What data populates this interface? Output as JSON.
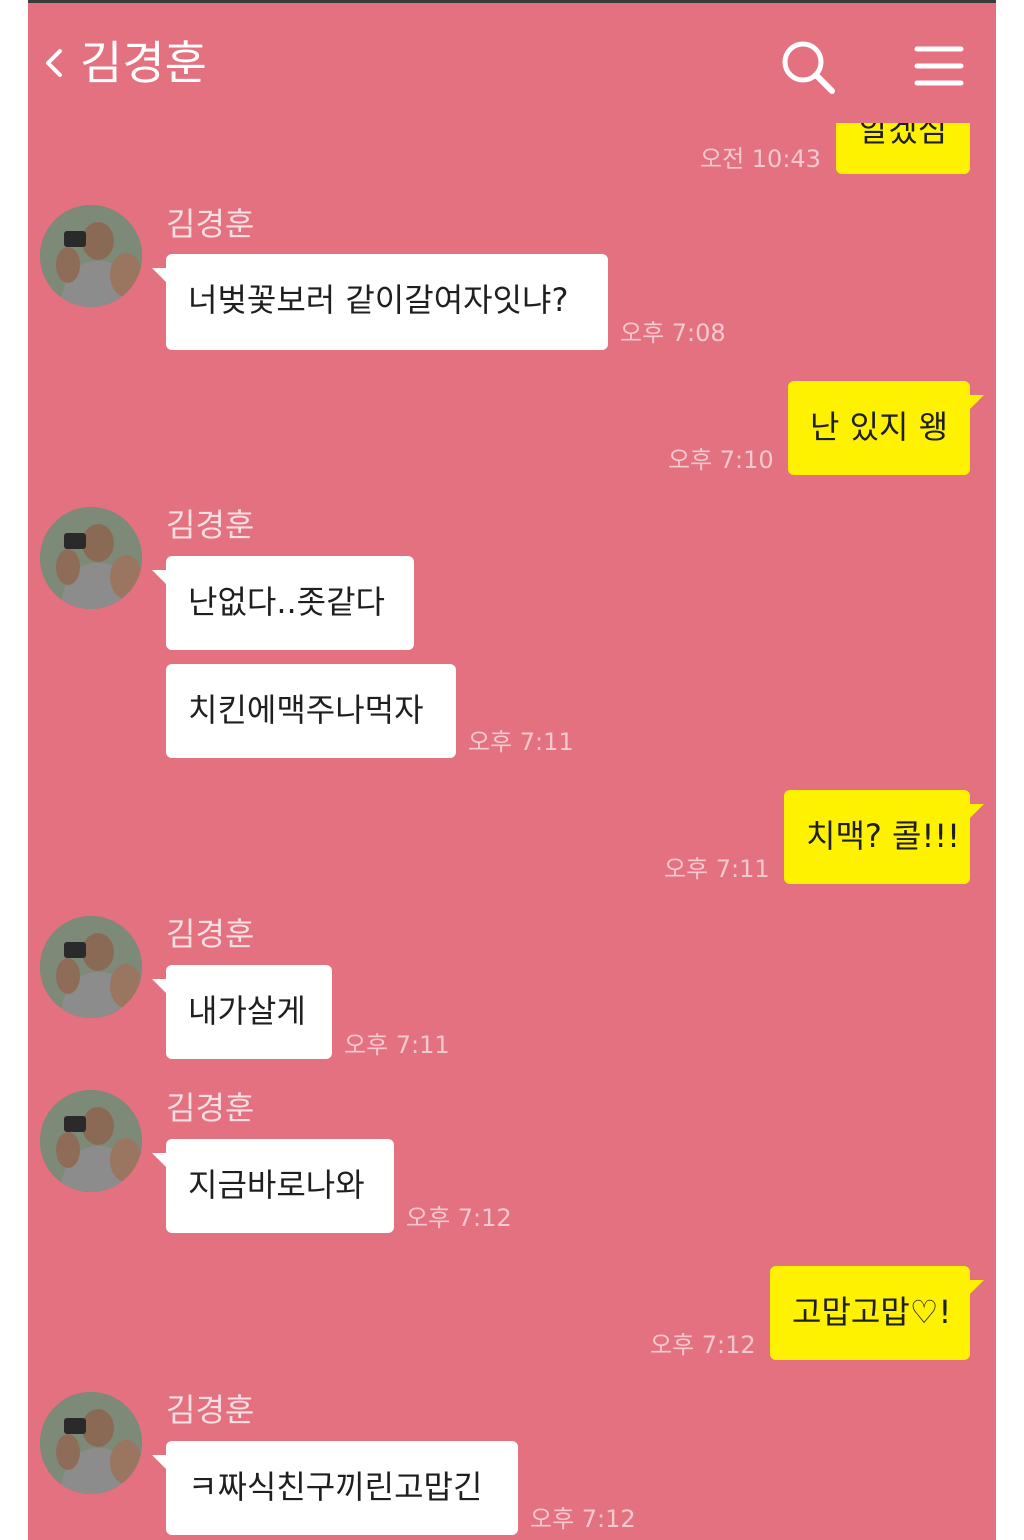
{
  "header": {
    "title": "김경훈"
  },
  "icons": {
    "back": "chevron-left-icon",
    "search": "search-icon",
    "menu": "menu-icon"
  },
  "colors": {
    "background": "#e4717f",
    "incoming_bubble": "#ffffff",
    "outgoing_bubble": "#fff200"
  },
  "messages": [
    {
      "direction": "out",
      "text": "알겠심",
      "time": "오전 10:43"
    },
    {
      "direction": "in",
      "sender": "김경훈",
      "text": "너벚꽃보러 같이갈여자잇냐?",
      "time": "오후 7:08"
    },
    {
      "direction": "out",
      "text": "난 있지 왱",
      "time": "오후 7:10"
    },
    {
      "direction": "in",
      "sender": "김경훈",
      "text": "난없다..좃같다"
    },
    {
      "direction": "in",
      "text": "치킨에맥주나먹자",
      "time": "오후 7:11"
    },
    {
      "direction": "out",
      "text": "치맥? 콜!!!",
      "time": "오후 7:11"
    },
    {
      "direction": "in",
      "text": "내가살게",
      "time": "오후 7:11"
    },
    {
      "direction": "in",
      "sender": "김경훈",
      "text": "지금바로나와",
      "time": "오후 7:12"
    },
    {
      "direction": "out",
      "text": "고맙고맙♡!",
      "time": "오후 7:12"
    },
    {
      "direction": "in",
      "sender": "김경훈",
      "text": "ㅋ짜식친구끼린고맙긴",
      "time": "오후 7:12"
    }
  ]
}
